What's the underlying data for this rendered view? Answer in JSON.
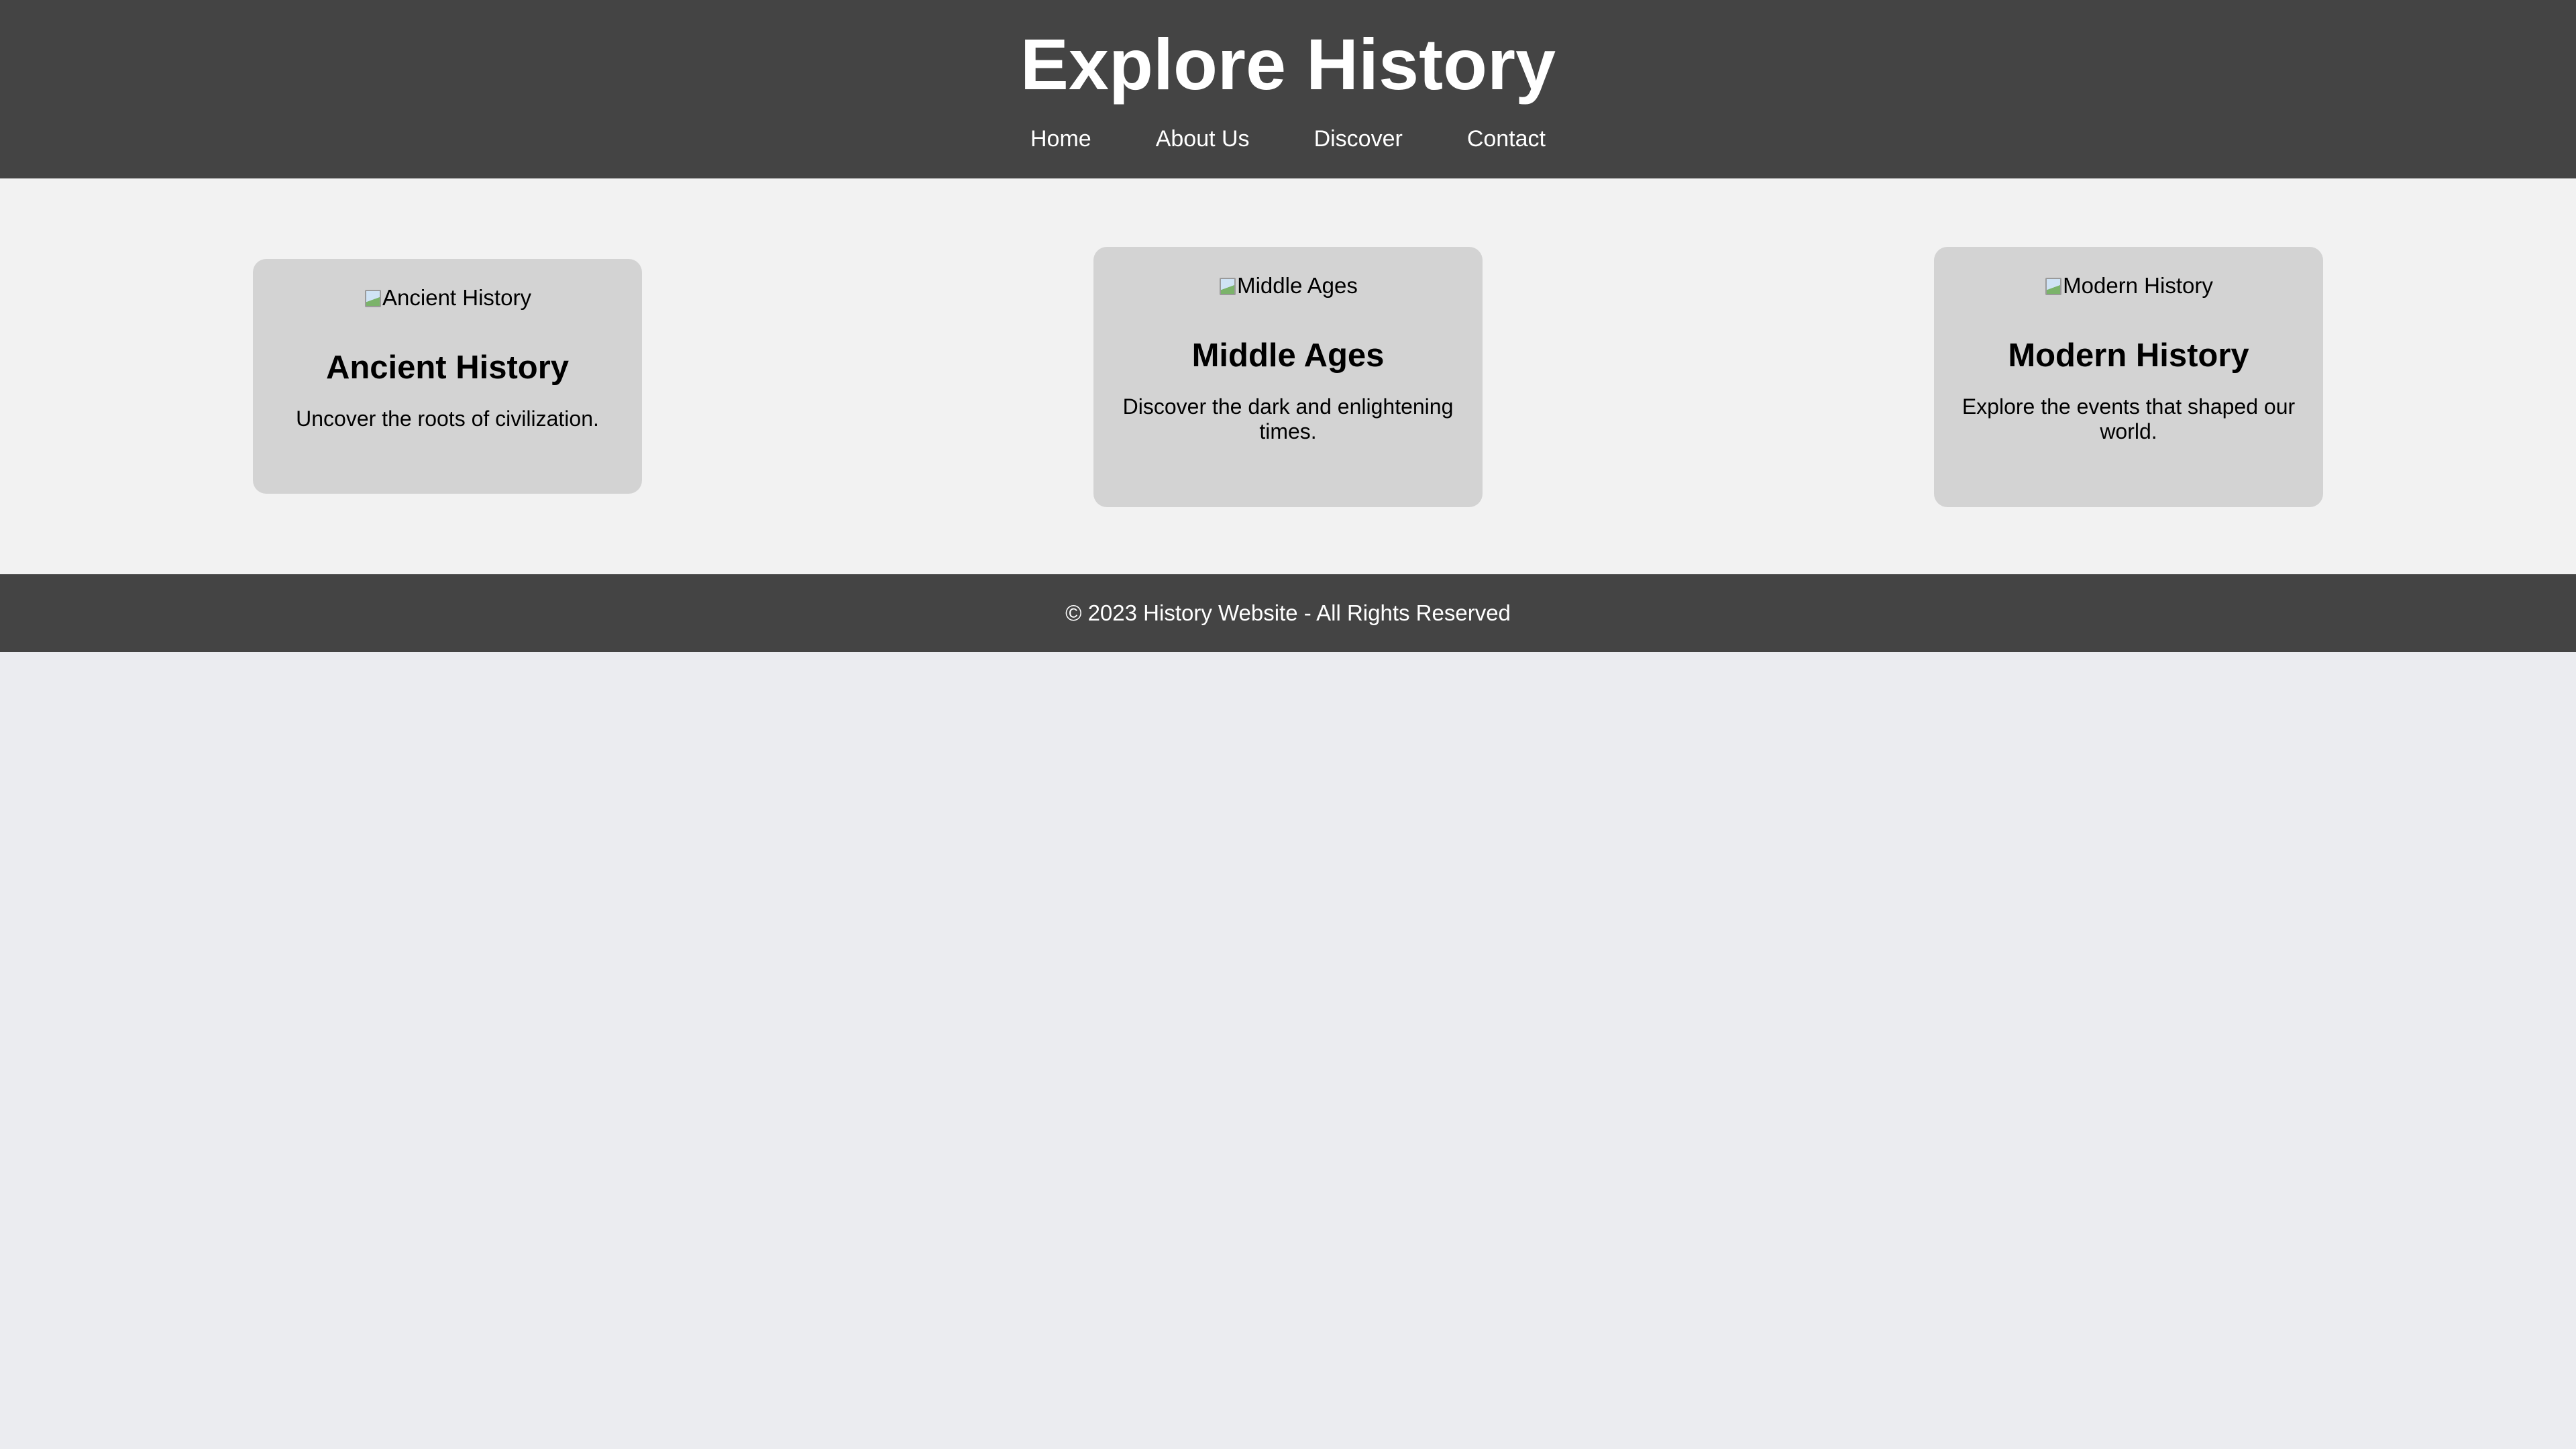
{
  "header": {
    "title": "Explore History",
    "nav": [
      "Home",
      "About Us",
      "Discover",
      "Contact"
    ]
  },
  "cards": [
    {
      "image_alt": "Ancient History",
      "title": "Ancient History",
      "description": "Uncover the roots of civilization."
    },
    {
      "image_alt": "Middle Ages",
      "title": "Middle Ages",
      "description": "Discover the dark and enlightening times."
    },
    {
      "image_alt": "Modern History",
      "title": "Modern History",
      "description": "Explore the events that shaped our world."
    }
  ],
  "footer": {
    "text": "© 2023 History Website - All Rights Reserved"
  },
  "colors": {
    "header_bg": "#444444",
    "section_bg": "#f2f2f2",
    "card_bg": "#d3d3d3",
    "page_bg": "#ebecf0",
    "text_light": "#ffffff"
  }
}
